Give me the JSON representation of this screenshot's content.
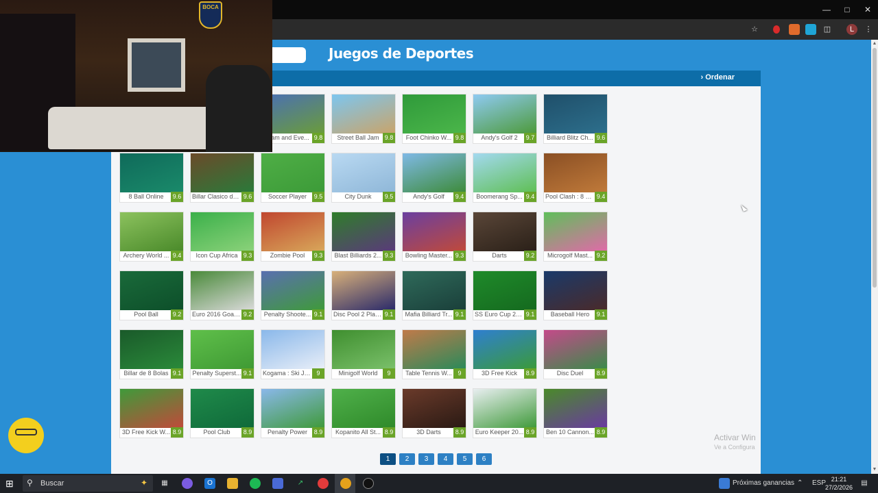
{
  "page": {
    "section_title": "Juegos de Deportes",
    "sort_label": "Ordenar"
  },
  "games": [
    {
      "name": "Slam and Eve...",
      "score": "9.8"
    },
    {
      "name": "Street Ball Jam",
      "score": "9.8"
    },
    {
      "name": "Foot Chinko W...",
      "score": "9.8"
    },
    {
      "name": "Andy's Golf 2",
      "score": "9.7"
    },
    {
      "name": "Billiard Blitz Ch...",
      "score": "9.6"
    },
    {
      "name": "8 Ball Online",
      "score": "9.6"
    },
    {
      "name": "Billar Clasico de...",
      "score": "9.6"
    },
    {
      "name": "Soccer Player",
      "score": "9.5"
    },
    {
      "name": "City Dunk",
      "score": "9.5"
    },
    {
      "name": "Andy's Golf",
      "score": "9.4"
    },
    {
      "name": "Boomerang Sp...",
      "score": "9.4"
    },
    {
      "name": "Pool Clash : 8 Bi...",
      "score": "9.4"
    },
    {
      "name": "Archery World ...",
      "score": "9.4"
    },
    {
      "name": "Icon Cup Africa",
      "score": "9.3"
    },
    {
      "name": "Zombie Pool",
      "score": "9.3"
    },
    {
      "name": "Blast Billiards 2...",
      "score": "9.3"
    },
    {
      "name": "Bowling Master...",
      "score": "9.3"
    },
    {
      "name": "Darts",
      "score": "9.2"
    },
    {
      "name": "Microgolf Mast...",
      "score": "9.2"
    },
    {
      "name": "Pool Ball",
      "score": "9.2"
    },
    {
      "name": "Euro 2016 Goal ...",
      "score": "9.2"
    },
    {
      "name": "Penalty Shoote...",
      "score": "9.1"
    },
    {
      "name": "Disc Pool 2 Play...",
      "score": "9.1"
    },
    {
      "name": "Mafia Billiard Tr...",
      "score": "9.1"
    },
    {
      "name": "SS Euro Cup 2021",
      "score": "9.1"
    },
    {
      "name": "Baseball Hero",
      "score": "9.1"
    },
    {
      "name": "Billar de 8 Bolas",
      "score": "9.1"
    },
    {
      "name": "Penalty Superst...",
      "score": "9.1"
    },
    {
      "name": "Kogama : Ski Ju...",
      "score": "9"
    },
    {
      "name": "Minigolf World",
      "score": "9"
    },
    {
      "name": "Table Tennis W...",
      "score": "9"
    },
    {
      "name": "3D Free Kick",
      "score": "8.9"
    },
    {
      "name": "Disc Duel",
      "score": "8.9"
    },
    {
      "name": "3D Free Kick W...",
      "score": "8.9"
    },
    {
      "name": "Pool Club",
      "score": "8.9"
    },
    {
      "name": "Penalty Power",
      "score": "8.9"
    },
    {
      "name": "Kopanito All St...",
      "score": "8.9"
    },
    {
      "name": "3D Darts",
      "score": "8.9"
    },
    {
      "name": "Euro Keeper 20...",
      "score": "8.9"
    },
    {
      "name": "Ben 10 Cannon...",
      "score": "8.9"
    }
  ],
  "pagination": [
    "1",
    "2",
    "3",
    "4",
    "5",
    "6"
  ],
  "current_page": "1",
  "watermark": {
    "title": "Activar Win",
    "subtitle": "Ve a Configura"
  },
  "webcam": {
    "badge_text": "BOCA"
  },
  "taskbar": {
    "search_label": "Buscar",
    "news_label": "Próximas ganancias",
    "lang": "ESP",
    "time": "21:21",
    "date": "27/2/2026"
  },
  "colors": {
    "page_bg": "#2a8fd4",
    "panel_header": "#0d6da8",
    "score_badge": "#6aa428",
    "pager": "#2d80c4"
  }
}
